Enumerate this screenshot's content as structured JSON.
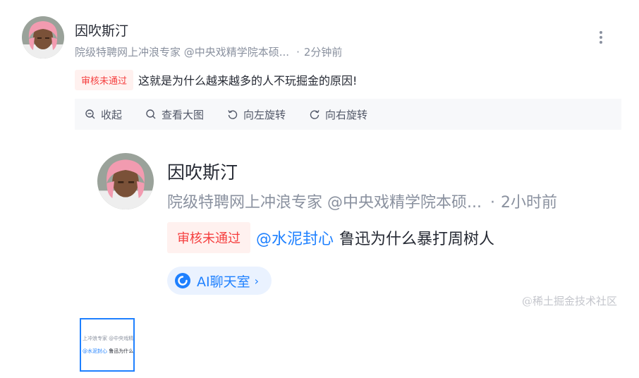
{
  "post": {
    "author": "因吹斯汀",
    "meta": "院级特聘网上冲浪专家 @中央戏精学院本硕...",
    "time": "2分钟前",
    "badge": "审核未通过",
    "content": "这就是为什么越来越多的人不玩掘金的原因!"
  },
  "toolbar": {
    "collapse": "收起",
    "view_large": "查看大图",
    "rotate_left": "向左旋转",
    "rotate_right": "向右旋转"
  },
  "preview": {
    "author": "因吹斯汀",
    "meta": "院级特聘网上冲浪专家 @中央戏精学院本硕...",
    "time": "2小时前",
    "badge": "审核未通过",
    "mention": "@水泥封心",
    "content": "鲁迅为什么暴打周树人",
    "ai_chip": "AI聊天室",
    "watermark": "@稀土掘金技术社区"
  },
  "thumbnail": {
    "line1": "上冲浪专家 @中央戏精学院",
    "mention": "@水泥封心",
    "line2": "鲁迅为什么暴"
  },
  "icons": [
    "avatar",
    "more-icon",
    "zoom-out-icon",
    "search-icon",
    "rotate-left-icon",
    "rotate-right-icon",
    "ai-icon",
    "chevron-right-icon"
  ],
  "colors": {
    "accent": "#1e80ff",
    "badge_bg": "#fff1ef",
    "badge_text": "#f53f3f",
    "meta_text": "#8a919f"
  }
}
